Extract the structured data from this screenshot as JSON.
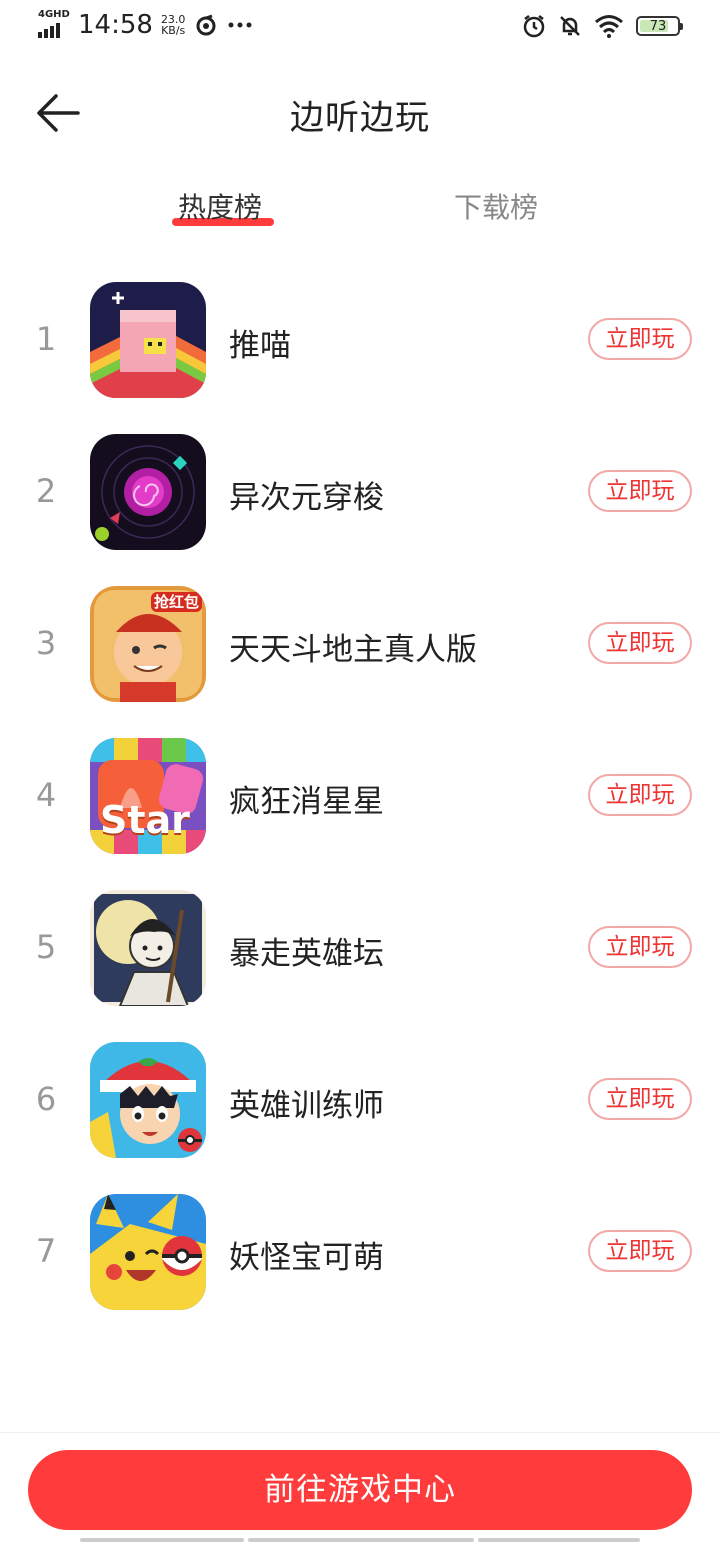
{
  "status_bar": {
    "network": "4GHD",
    "time": "14:58",
    "speed_value": "23.0",
    "speed_unit": "KB/s",
    "battery": "73"
  },
  "header": {
    "title": "边听边玩"
  },
  "tabs": [
    {
      "label": "热度榜",
      "active": true
    },
    {
      "label": "下载榜",
      "active": false
    }
  ],
  "games": [
    {
      "rank": "1",
      "name": "推喵",
      "action": "立即玩"
    },
    {
      "rank": "2",
      "name": "异次元穿梭",
      "action": "立即玩"
    },
    {
      "rank": "3",
      "name": "天天斗地主真人版",
      "action": "立即玩",
      "badge": "抢红包"
    },
    {
      "rank": "4",
      "name": "疯狂消星星",
      "action": "立即玩",
      "badge": "Star"
    },
    {
      "rank": "5",
      "name": "暴走英雄坛",
      "action": "立即玩"
    },
    {
      "rank": "6",
      "name": "英雄训练师",
      "action": "立即玩"
    },
    {
      "rank": "7",
      "name": "妖怪宝可萌",
      "action": "立即玩"
    }
  ],
  "footer": {
    "cta_label": "前往游戏中心"
  },
  "colors": {
    "accent": "#ff3b3b",
    "button_border": "#f3a7a7"
  }
}
